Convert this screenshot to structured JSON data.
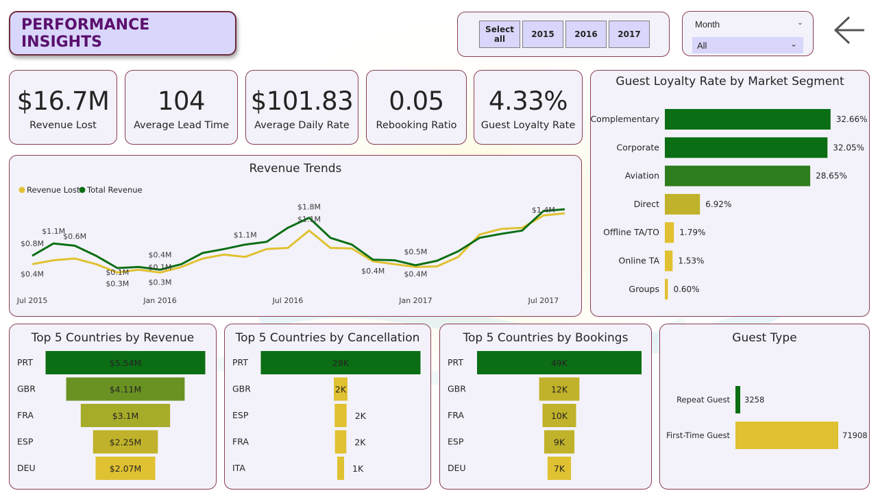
{
  "header": {
    "title": "PERFORMANCE INSIGHTS"
  },
  "year_filter": {
    "buttons": [
      "Select all",
      "2015",
      "2016",
      "2017"
    ]
  },
  "month_filter": {
    "label": "Month",
    "selected": "All"
  },
  "kpis": [
    {
      "value": "$16.7M",
      "label": "Revenue Lost"
    },
    {
      "value": "104",
      "label": "Average Lead Time"
    },
    {
      "value": "$101.83",
      "label": "Average Daily Rate"
    },
    {
      "value": "0.05",
      "label": "Rebooking Ratio"
    },
    {
      "value": "4.33%",
      "label": "Guest Loyalty Rate"
    }
  ],
  "panels": {
    "revenue_trends": "Revenue Trends",
    "loyalty": "Guest Loyalty Rate by Market Segment",
    "top_revenue": "Top 5 Countries by Revenue",
    "top_cancel": "Top 5 Countries by Cancellation",
    "top_bookings": "Top 5 Countries by Bookings",
    "guest_type": "Guest Type"
  },
  "colors": {
    "dark_green": "#0b6e14",
    "mid_green": "#2e7d1e",
    "olive_green": "#6a9223",
    "olive": "#a7ab2a",
    "mustard": "#c0b22a",
    "yellow": "#e0c131",
    "accent_text": "#5a0f6d"
  },
  "chart_data": [
    {
      "type": "line",
      "title": "Revenue Trends",
      "x_tick_labels": [
        "Jul 2015",
        "Jan 2016",
        "Jul 2016",
        "Jan 2017",
        "Jul 2017"
      ],
      "x": [
        "2015-07",
        "2015-08",
        "2015-09",
        "2015-10",
        "2015-11",
        "2015-12",
        "2016-01",
        "2016-02",
        "2016-03",
        "2016-04",
        "2016-05",
        "2016-06",
        "2016-07",
        "2016-08",
        "2016-09",
        "2016-10",
        "2016-11",
        "2016-12",
        "2017-01",
        "2017-02",
        "2017-03",
        "2017-04",
        "2017-05",
        "2017-06",
        "2017-07",
        "2017-08"
      ],
      "series": [
        {
          "name": "Revenue Lost",
          "values": [
            0.45,
            0.52,
            0.55,
            0.45,
            0.3,
            0.35,
            0.3,
            0.4,
            0.55,
            0.62,
            0.58,
            0.72,
            0.74,
            1.05,
            0.74,
            0.73,
            0.5,
            0.45,
            0.4,
            0.41,
            0.58,
            0.98,
            1.08,
            1.1,
            1.32,
            1.36
          ]
        },
        {
          "name": "Total Revenue",
          "values": [
            0.6,
            0.82,
            0.78,
            0.6,
            0.38,
            0.4,
            0.35,
            0.45,
            0.65,
            0.72,
            0.8,
            0.85,
            1.1,
            1.28,
            0.92,
            0.8,
            0.53,
            0.52,
            0.43,
            0.51,
            0.68,
            0.92,
            0.99,
            1.05,
            1.4,
            1.43
          ]
        }
      ],
      "data_labels": [
        "$0.8M",
        "$0.4M",
        "$1.1M",
        "$0.6M",
        "$0.1M",
        "$0.3M",
        "$0.4M",
        "$0.1M",
        "$0.3M",
        "$1.1M",
        "$1.8M",
        "$1.1M",
        "$0.4M",
        "$0.5M",
        "$0.4M",
        "$1.4M"
      ],
      "legend": "top-left"
    },
    {
      "type": "bar",
      "orientation": "horizontal",
      "title": "Guest Loyalty Rate by Market Segment",
      "categories": [
        "Complementary",
        "Corporate",
        "Aviation",
        "Direct",
        "Offline TA/TO",
        "Online TA",
        "Groups"
      ],
      "values": [
        32.66,
        32.05,
        28.65,
        6.92,
        1.79,
        1.53,
        0.6
      ],
      "value_labels": [
        "32.66%",
        "32.05%",
        "28.65%",
        "6.92%",
        "1.79%",
        "1.53%",
        "0.60%"
      ]
    },
    {
      "type": "bar",
      "orientation": "funnel",
      "title": "Top 5 Countries by Revenue",
      "categories": [
        "PRT",
        "GBR",
        "FRA",
        "ESP",
        "DEU"
      ],
      "values": [
        5.54,
        4.11,
        3.1,
        2.25,
        2.07
      ],
      "value_labels": [
        "$5.54M",
        "$4.11M",
        "$3.1M",
        "$2.25M",
        "$2.07M"
      ]
    },
    {
      "type": "bar",
      "orientation": "funnel",
      "title": "Top 5 Countries by Cancellation",
      "categories": [
        "PRT",
        "GBR",
        "ESP",
        "FRA",
        "ITA"
      ],
      "values": [
        28,
        2.4,
        2.1,
        2.0,
        1.2
      ],
      "value_labels": [
        "28K",
        "2K",
        "2K",
        "2K",
        "1K"
      ]
    },
    {
      "type": "bar",
      "orientation": "funnel",
      "title": "Top 5 Countries by Bookings",
      "categories": [
        "PRT",
        "GBR",
        "FRA",
        "ESP",
        "DEU"
      ],
      "values": [
        49,
        12,
        10,
        9,
        7
      ],
      "value_labels": [
        "49K",
        "12K",
        "10K",
        "9K",
        "7K"
      ]
    },
    {
      "type": "bar",
      "orientation": "horizontal",
      "title": "Guest Type",
      "categories": [
        "Repeat Guest",
        "First-Time Guest"
      ],
      "values": [
        3258,
        71908
      ],
      "value_labels": [
        "3258",
        "71908"
      ]
    }
  ]
}
